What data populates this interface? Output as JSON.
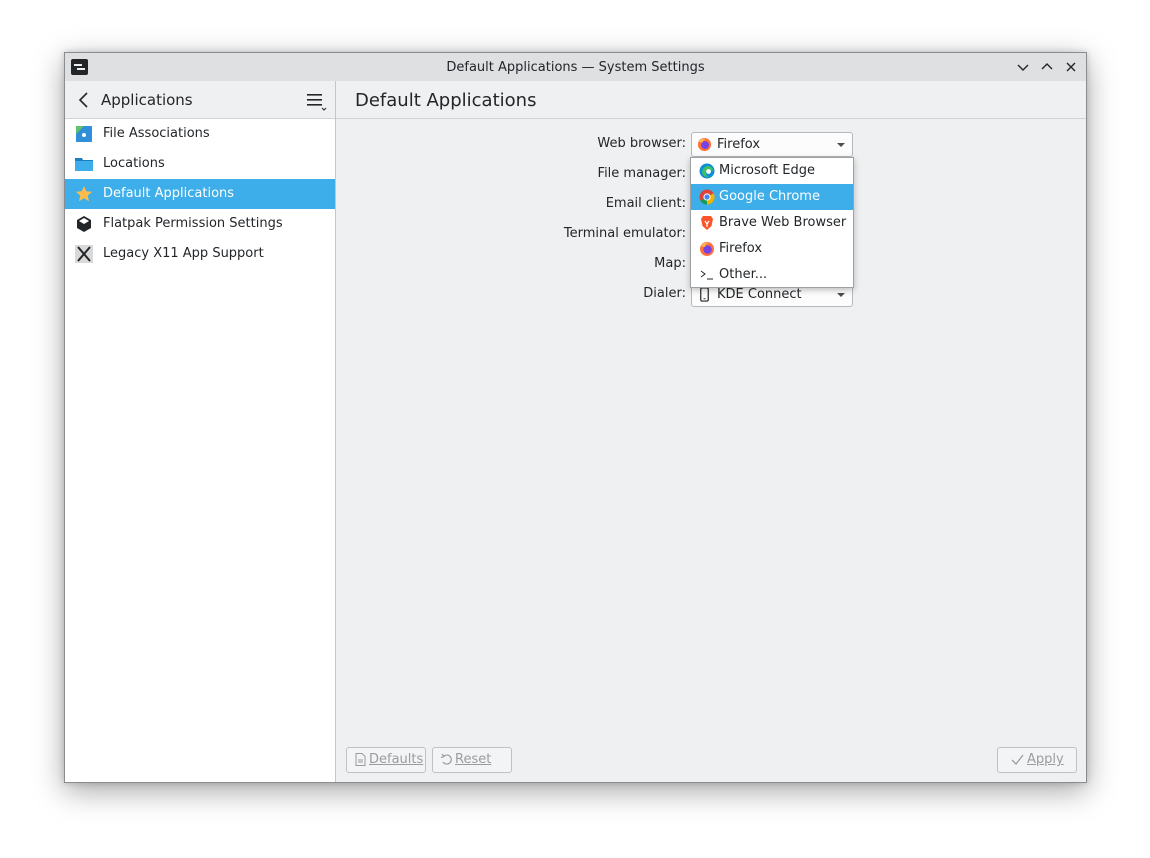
{
  "window": {
    "title": "Default Applications — System Settings"
  },
  "sidebar": {
    "title": "Applications",
    "items": [
      {
        "label": "File Associations",
        "icon": "file-associations-icon"
      },
      {
        "label": "Locations",
        "icon": "folder-icon"
      },
      {
        "label": "Default Applications",
        "icon": "star-icon",
        "selected": true
      },
      {
        "label": "Flatpak Permission Settings",
        "icon": "flatpak-icon"
      },
      {
        "label": "Legacy X11 App Support",
        "icon": "x11-icon"
      }
    ]
  },
  "page": {
    "title": "Default Applications",
    "fields": [
      {
        "label": "Web browser:",
        "value": "Firefox"
      },
      {
        "label": "File manager:"
      },
      {
        "label": "Email client:"
      },
      {
        "label": "Terminal emulator:"
      },
      {
        "label": "Map:"
      },
      {
        "label": "Dialer:",
        "value": "KDE Connect"
      }
    ],
    "browser_options": [
      {
        "label": "Microsoft Edge",
        "icon": "edge-icon"
      },
      {
        "label": "Google Chrome",
        "icon": "chrome-icon",
        "highlighted": true
      },
      {
        "label": "Brave Web Browser",
        "icon": "brave-icon"
      },
      {
        "label": "Firefox",
        "icon": "firefox-icon"
      },
      {
        "label": "Other...",
        "icon": "terminal-icon"
      }
    ]
  },
  "footer": {
    "defaults_label": "Defaults",
    "reset_label": "Reset",
    "apply_label": "Apply"
  },
  "colors": {
    "accent": "#3daee9",
    "window_bg": "#eff0f1",
    "text": "#232629"
  }
}
